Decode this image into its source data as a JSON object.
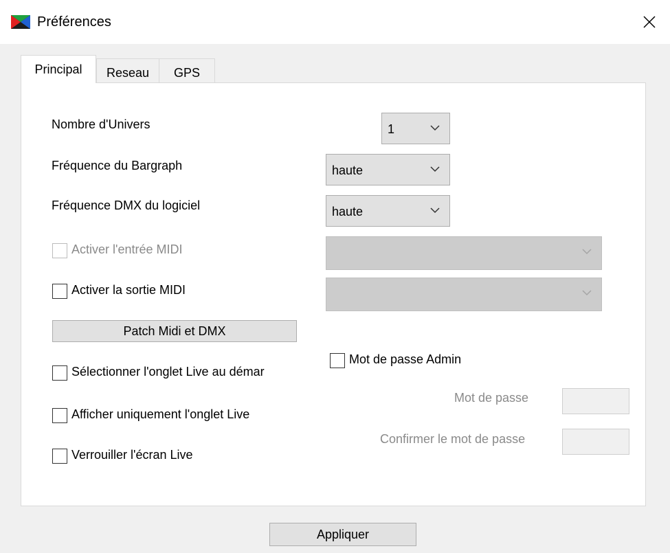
{
  "window": {
    "title": "Préférences",
    "app_icon": "app-logo-icon",
    "close_icon": "close-icon"
  },
  "tabs": [
    {
      "label": "Principal",
      "active": true
    },
    {
      "label": "Reseau",
      "active": false
    },
    {
      "label": "GPS",
      "active": false
    }
  ],
  "principal": {
    "universes": {
      "label": "Nombre d'Univers",
      "value": "1"
    },
    "bargraph_freq": {
      "label": "Fréquence du Bargraph",
      "value": "haute"
    },
    "dmx_freq": {
      "label": "Fréquence DMX du logiciel",
      "value": "haute"
    },
    "midi_in": {
      "label": "Activer l'entrée MIDI",
      "checked": false,
      "enabled": false,
      "device": ""
    },
    "midi_out": {
      "label": "Activer la sortie MIDI",
      "checked": false,
      "enabled": true,
      "device": ""
    },
    "patch_button": "Patch Midi et DMX",
    "select_live_tab": {
      "label": "Sélectionner l'onglet Live au démar",
      "checked": false
    },
    "show_only_live": {
      "label": "Afficher uniquement l'onglet Live",
      "checked": false
    },
    "lock_live": {
      "label": "Verrouiller l'écran Live",
      "checked": false
    },
    "admin_password": {
      "label": "Mot de passe Admin",
      "checked": false
    },
    "password": {
      "label": "Mot de passe",
      "value": ""
    },
    "confirm_password": {
      "label": "Confirmer le mot de passe",
      "value": ""
    }
  },
  "footer": {
    "apply_button": "Appliquer"
  }
}
